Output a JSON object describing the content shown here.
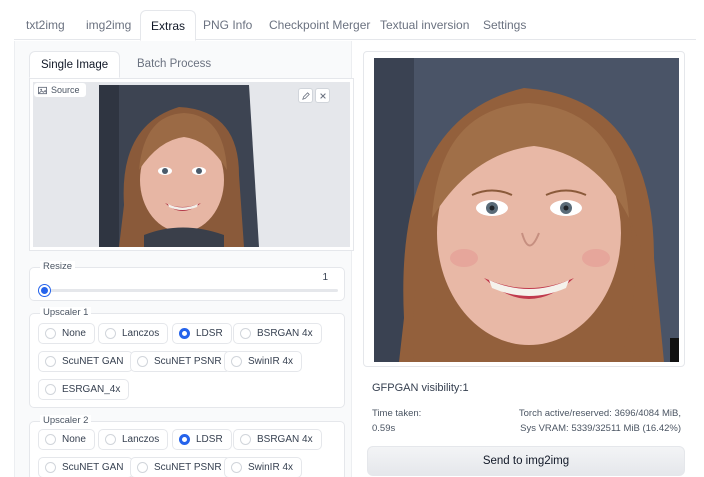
{
  "tabs": [
    "txt2img",
    "img2img",
    "Extras",
    "PNG Info",
    "Checkpoint Merger",
    "Textual inversion",
    "Settings"
  ],
  "active_tab": "Extras",
  "subtabs": [
    "Single Image",
    "Batch Process"
  ],
  "source": {
    "label": "Source"
  },
  "resize": {
    "label": "Resize",
    "value": 1,
    "min": 1,
    "max": 8
  },
  "upscaler1": {
    "label": "Upscaler 1",
    "options": [
      "None",
      "Lanczos",
      "LDSR",
      "BSRGAN 4x",
      "ScuNET GAN",
      "ScuNET PSNR",
      "SwinIR 4x",
      "ESRGAN_4x"
    ],
    "selected": "LDSR"
  },
  "upscaler2": {
    "label": "Upscaler 2",
    "options": [
      "None",
      "Lanczos",
      "LDSR",
      "BSRGAN 4x",
      "ScuNET GAN",
      "ScuNET PSNR",
      "SwinIR 4x"
    ],
    "selected": "LDSR"
  },
  "output": {
    "gfpgan": "GFPGAN visibility:1",
    "time_label": "Time taken:",
    "time_value": "0.59s",
    "torch": "Torch active/reserved: 3696/4084 MiB,",
    "vram": "Sys VRAM: 5339/32511 MiB (16.42%)",
    "send_button": "Send to img2img"
  },
  "colors": {
    "accent": "#2563eb"
  }
}
